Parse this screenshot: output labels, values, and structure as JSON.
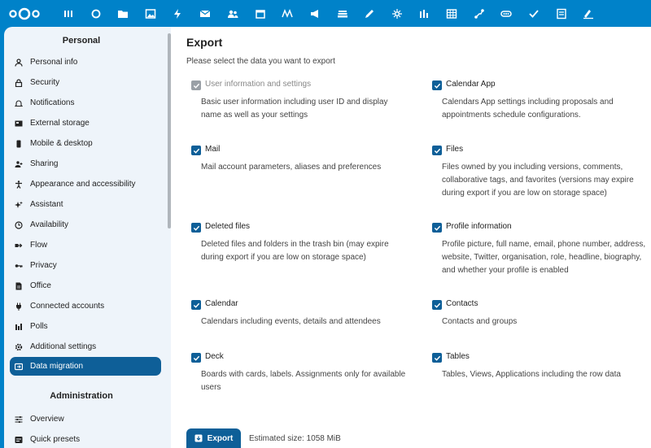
{
  "topbar": {
    "apps": [
      "dashboard-icon",
      "search-icon",
      "files-icon",
      "photos-icon",
      "activity-icon",
      "mail-icon",
      "contacts-icon",
      "calendar-icon",
      "notes-icon",
      "announcements-icon",
      "deck-icon",
      "text-icon",
      "assistant-icon",
      "analytics-icon",
      "tables-icon",
      "flow-icon",
      "passwords-icon",
      "tasks-icon",
      "forms-icon",
      "whiteboard-icon"
    ]
  },
  "sidebar": {
    "personal_heading": "Personal",
    "items": [
      {
        "label": "Personal info",
        "icon": "user-icon"
      },
      {
        "label": "Security",
        "icon": "lock-icon"
      },
      {
        "label": "Notifications",
        "icon": "bell-icon"
      },
      {
        "label": "External storage",
        "icon": "storage-icon"
      },
      {
        "label": "Mobile & desktop",
        "icon": "phone-icon"
      },
      {
        "label": "Sharing",
        "icon": "share-icon"
      },
      {
        "label": "Appearance and accessibility",
        "icon": "accessibility-icon"
      },
      {
        "label": "Assistant",
        "icon": "sparkle-icon"
      },
      {
        "label": "Availability",
        "icon": "clock-icon"
      },
      {
        "label": "Flow",
        "icon": "flow-icon"
      },
      {
        "label": "Privacy",
        "icon": "key-icon"
      },
      {
        "label": "Office",
        "icon": "document-icon"
      },
      {
        "label": "Connected accounts",
        "icon": "plug-icon"
      },
      {
        "label": "Polls",
        "icon": "poll-icon"
      },
      {
        "label": "Additional settings",
        "icon": "gear-icon"
      },
      {
        "label": "Data migration",
        "icon": "migration-icon",
        "active": true
      }
    ],
    "admin_heading": "Administration",
    "admin_items": [
      {
        "label": "Overview",
        "icon": "sliders-icon"
      },
      {
        "label": "Quick presets",
        "icon": "presets-icon"
      }
    ]
  },
  "main": {
    "title": "Export",
    "subtitle": "Please select the data you want to export",
    "options": [
      {
        "title": "User information and settings",
        "desc": "Basic user information including user ID and display name as well as your settings",
        "checked": true,
        "disabled": true
      },
      {
        "title": "Calendar App",
        "desc": "Calendars App settings including proposals and appointments schedule configurations.",
        "checked": true
      },
      {
        "title": "Mail",
        "desc": "Mail account parameters, aliases and preferences",
        "checked": true
      },
      {
        "title": "Files",
        "desc": "Files owned by you including versions, comments, collaborative tags, and favorites (versions may expire during export if you are low on storage space)",
        "checked": true
      },
      {
        "title": "Deleted files",
        "desc": "Deleted files and folders in the trash bin (may expire during export if you are low on storage space)",
        "checked": true
      },
      {
        "title": "Profile information",
        "desc": "Profile picture, full name, email, phone number, address, website, Twitter, organisation, role, headline, biography, and whether your profile is enabled",
        "checked": true
      },
      {
        "title": "Calendar",
        "desc": "Calendars including events, details and attendees",
        "checked": true
      },
      {
        "title": "Contacts",
        "desc": "Contacts and groups",
        "checked": true
      },
      {
        "title": "Deck",
        "desc": "Boards with cards, labels. Assignments only for available users",
        "checked": true
      },
      {
        "title": "Tables",
        "desc": "Tables, Views, Applications including the row data",
        "checked": true
      }
    ],
    "export_label": "Export",
    "estimated_size": "Estimated size: 1058 MiB"
  },
  "colors": {
    "header": "#0082c9",
    "accent": "#0e5f98",
    "sidebar_bg": "#eef4fa"
  }
}
